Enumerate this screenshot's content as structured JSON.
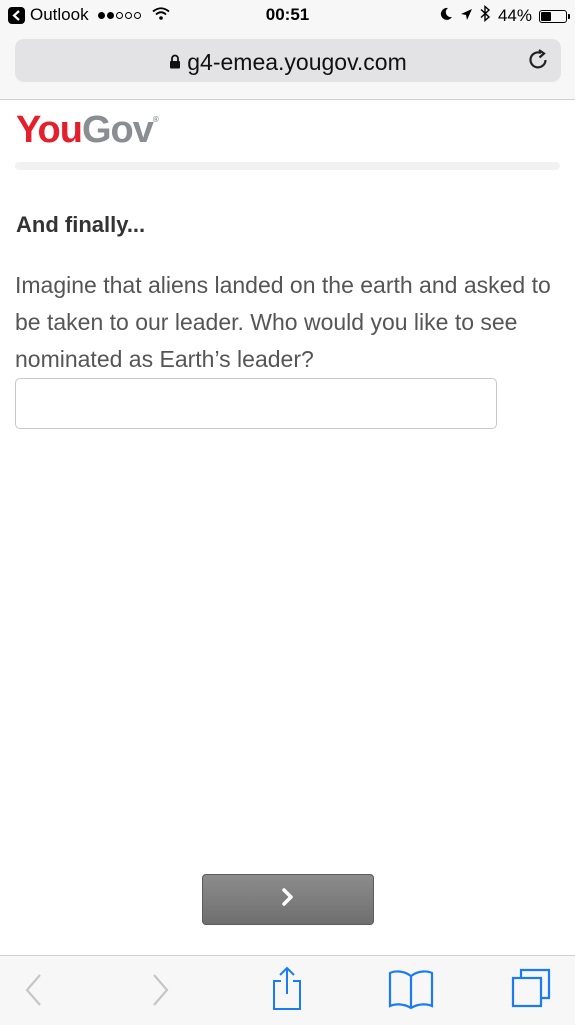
{
  "status_bar": {
    "back_app": "Outlook",
    "time": "00:51",
    "battery_text": "44%",
    "battery_level": 0.44,
    "signal_bars_filled": 2,
    "signal_bars_total": 5
  },
  "browser": {
    "url": "g4-emea.yougov.com"
  },
  "logo": {
    "part1": "You",
    "part2": "Gov",
    "mark": "®",
    "colors": {
      "you": "#e4202c",
      "gov": "#8a8d91"
    }
  },
  "survey": {
    "heading": "And finally...",
    "question": "Imagine that aliens landed on the earth and asked to be taken to our leader. Who would you like to see nominated as Earth’s leader?",
    "answer_value": "",
    "next_icon": "chevron-right-icon"
  },
  "toolbar": {
    "icons": [
      "back-icon",
      "forward-icon",
      "share-icon",
      "bookmarks-icon",
      "tabs-icon"
    ],
    "accent": "#1a7cf5"
  }
}
